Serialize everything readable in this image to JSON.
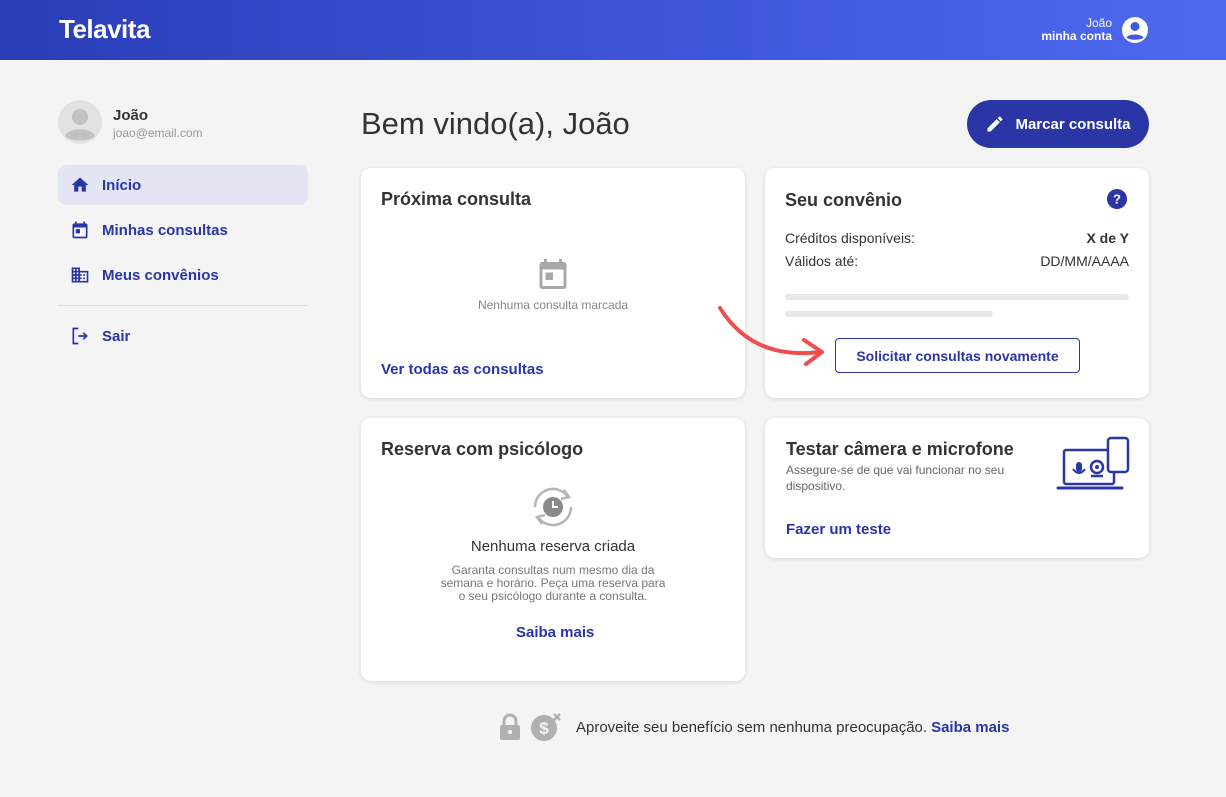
{
  "brand": {
    "logo": "Telavita",
    "accent": "#2a35a6"
  },
  "account": {
    "name": "João",
    "label": "minha conta",
    "icon": "account-circle-icon"
  },
  "profile": {
    "name": "João",
    "email": "joao@email.com",
    "icon": "avatar-icon"
  },
  "sidebar": {
    "items": [
      {
        "label": "Início",
        "icon": "home-icon",
        "active": true
      },
      {
        "label": "Minhas consultas",
        "icon": "calendar-icon",
        "active": false
      },
      {
        "label": "Meus convênios",
        "icon": "building-icon",
        "active": false
      }
    ],
    "logout": {
      "label": "Sair",
      "icon": "logout-icon"
    }
  },
  "main": {
    "welcome": "Bem vindo(a), João",
    "book_button": "Marcar consulta"
  },
  "next_appointment": {
    "title": "Próxima consulta",
    "empty_text": "Nenhuma consulta marcada",
    "link": "Ver todas as consultas"
  },
  "insurance": {
    "title": "Seu convênio",
    "credits_label": "Créditos disponíveis:",
    "credits_value": "X de Y",
    "valid_label": "Válidos até:",
    "valid_value": "DD/MM/AAAA",
    "button": "Solicitar consultas novamente",
    "help_icon": "help-circle-icon"
  },
  "reservation": {
    "title": "Reserva com psicólogo",
    "empty_title": "Nenhuma reserva criada",
    "description_lines": [
      "Garanta consultas num mesmo dia da",
      "semana e horário. Peça uma reserva para",
      "o seu psicólogo durante a consulta."
    ],
    "link": "Saiba mais"
  },
  "device_test": {
    "title": "Testar câmera e microfone",
    "description_lines": [
      "Assegure-se de que vai funcionar no seu",
      "dispositivo."
    ],
    "link": "Fazer um teste"
  },
  "footer": {
    "text": "Aproveite seu benefício sem nenhuma preocupação.",
    "link": "Saiba mais"
  }
}
